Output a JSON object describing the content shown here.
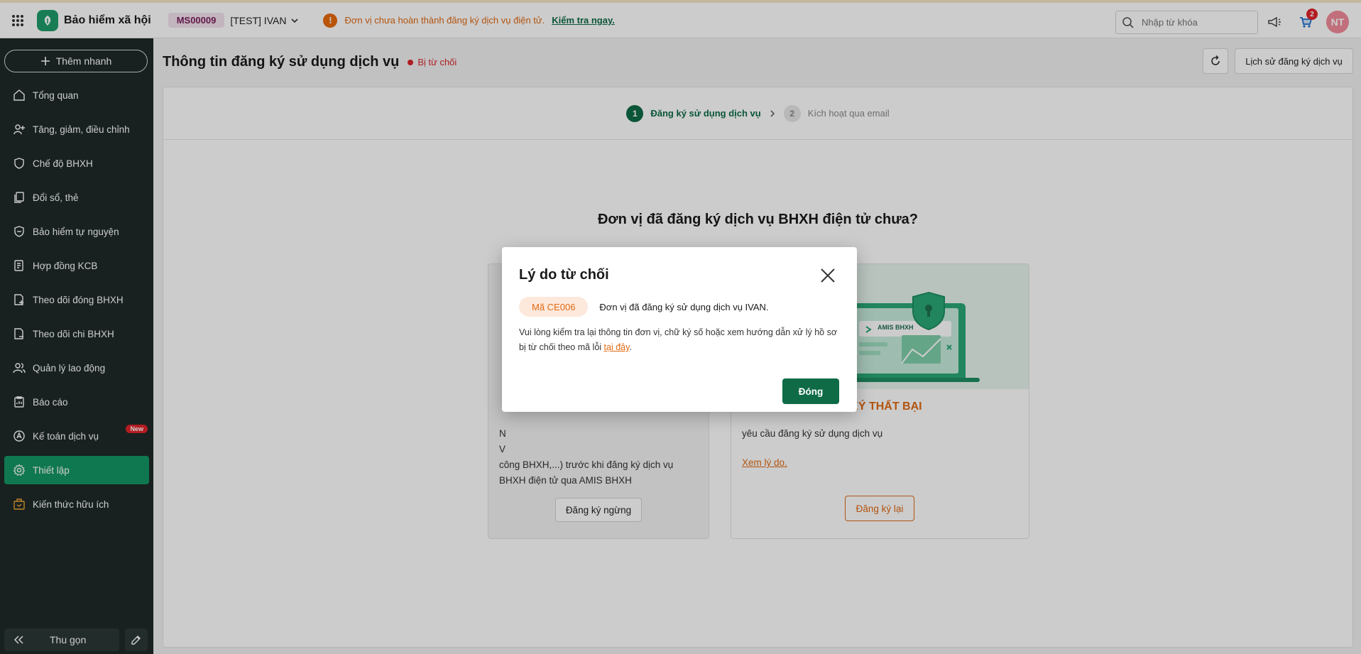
{
  "header": {
    "app_title": "Bảo hiểm xã hội",
    "unit_code": "MS00009",
    "unit_name": "[TEST] IVAN",
    "warning_text": "Đơn vị chưa hoàn thành đăng ký dịch vụ điện tử.",
    "warning_link": "Kiểm tra ngay.",
    "search_placeholder": "Nhập từ khóa",
    "cart_badge": "2",
    "avatar_initials": "NT"
  },
  "sidebar": {
    "quick_add": "Thêm nhanh",
    "items": [
      {
        "label": "Tổng quan",
        "icon": "home-icon"
      },
      {
        "label": "Tăng, giảm, điều chỉnh",
        "icon": "user-adjust-icon"
      },
      {
        "label": "Chế độ BHXH",
        "icon": "shield-heart-icon"
      },
      {
        "label": "Đổi sổ, thẻ",
        "icon": "document-copy-icon"
      },
      {
        "label": "Bảo hiểm tự nguyện",
        "icon": "shield-icon"
      },
      {
        "label": "Hợp đồng KCB",
        "icon": "contract-icon"
      },
      {
        "label": "Theo dõi đóng BHXH",
        "icon": "document-tracking-icon"
      },
      {
        "label": "Theo dõi chi BHXH",
        "icon": "document-payout-icon"
      },
      {
        "label": "Quản lý lao động",
        "icon": "users-icon"
      },
      {
        "label": "Báo cáo",
        "icon": "report-icon"
      },
      {
        "label": "Kế toán dịch vụ",
        "icon": "accounting-icon",
        "badge": "New"
      },
      {
        "label": "Thiết lập",
        "icon": "gear-icon",
        "active": true
      },
      {
        "label": "Kiến thức hữu ích",
        "icon": "knowledge-icon"
      }
    ],
    "collapse_label": "Thu gọn"
  },
  "main": {
    "page_title": "Thông tin đăng ký sử dụng dịch vụ",
    "status": "Bị từ chối",
    "history_button": "Lịch sử đăng ký dịch vụ",
    "steps": [
      {
        "num": "1",
        "label": "Đăng ký sử dụng dịch vụ"
      },
      {
        "num": "2",
        "label": "Kích hoạt qua email"
      }
    ],
    "question": "Đơn vị đã đăng ký dịch vụ BHXH điện tử chưa?",
    "left_option": {
      "desc_partial": "N\nV\ncông BHXH,...) trước khi đăng ký dịch vụ\nBHXH điện tử qua AMIS BHXH",
      "button": "Đăng ký ngừng"
    },
    "right_option": {
      "illustration_label": "AMIS BHXH",
      "title_partial": "G KÝ THẤT BẠI",
      "desc_partial": "yêu cầu đăng ký sử dụng dịch vụ",
      "reason_link": "Xem lý do.",
      "button": "Đăng ký lại"
    }
  },
  "modal": {
    "title": "Lý do từ chối",
    "error_code": "Mã CE006",
    "error_message": "Đơn vị đã đăng ký sử dụng dịch vụ IVAN.",
    "desc_prefix": "Vui lòng kiểm tra lại thông tin đơn vị, chữ ký số hoặc xem hướng dẫn xử lý hồ sơ bị từ chối theo mã lỗi ",
    "desc_link": "tại đây",
    "desc_suffix": ".",
    "close_button": "Đóng"
  },
  "colors": {
    "brand_green": "#0e6b46",
    "sidebar_bg": "#1e2a28",
    "active_nav": "#159765",
    "warning_orange": "#e06a13",
    "danger_red": "#d9262c"
  }
}
